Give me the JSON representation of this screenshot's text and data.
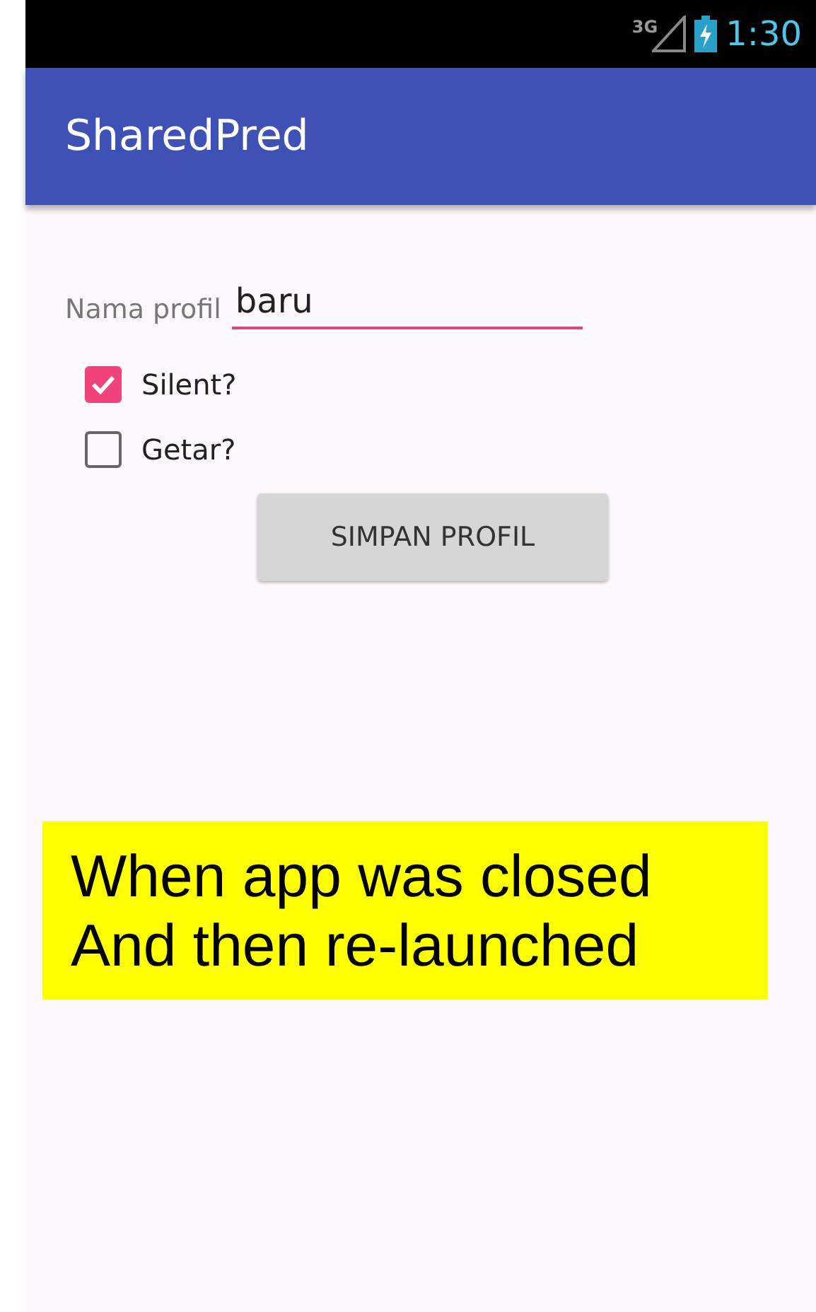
{
  "status_bar": {
    "network": "3G",
    "time": "1:30"
  },
  "app_bar": {
    "title": "SharedPred"
  },
  "form": {
    "field": {
      "label": "Nama profil",
      "value": "baru"
    },
    "checkboxes": [
      {
        "label": "Silent?",
        "checked": true
      },
      {
        "label": "Getar?",
        "checked": false
      }
    ],
    "button": "SIMPAN PROFIL"
  },
  "annotation": [
    "When app was closed",
    "And then re-launched"
  ]
}
